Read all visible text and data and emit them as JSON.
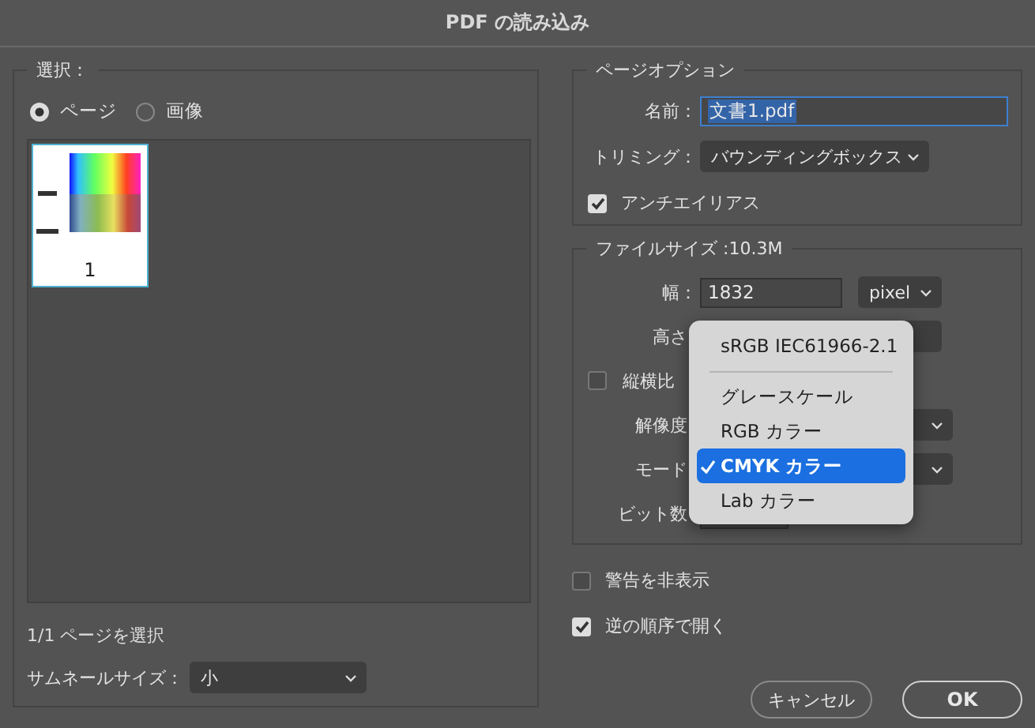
{
  "window": {
    "title": "PDF の読み込み"
  },
  "selection": {
    "legend": "選択：",
    "options": [
      {
        "label": "ページ",
        "selected": true
      },
      {
        "label": "画像",
        "selected": false
      }
    ],
    "thumbnails": [
      {
        "label": "1",
        "selected": true
      }
    ],
    "status": "1/1 ページを選択",
    "thumbnail_size": {
      "label": "サムネールサイズ：",
      "value": "小"
    }
  },
  "page_options": {
    "legend": "ページオプション",
    "name": {
      "label": "名前：",
      "value": "文書1.pdf"
    },
    "crop": {
      "label": "トリミング：",
      "value": "バウンディングボックス"
    },
    "antialias": {
      "label": "アンチエイリアス",
      "checked": true
    }
  },
  "image_size": {
    "legend": "ファイルサイズ :10.3M",
    "rows": [
      {
        "kind": "size",
        "label": "幅：",
        "value": "1832",
        "unit": "pixel"
      },
      {
        "kind": "size",
        "label": "高さ"
      },
      {
        "kind": "checkbox",
        "label": "縦横比",
        "checked": false
      },
      {
        "kind": "select",
        "label": "解像度"
      },
      {
        "kind": "select",
        "label": "モード"
      },
      {
        "kind": "field",
        "label": "ビット数"
      }
    ]
  },
  "mode_menu": {
    "items": [
      {
        "kind": "header",
        "label": "sRGB IEC61966-2.1"
      },
      {
        "kind": "separator"
      },
      {
        "kind": "option",
        "label": "グレースケール",
        "selected": false
      },
      {
        "kind": "option",
        "label": "RGB カラー",
        "selected": false
      },
      {
        "kind": "option",
        "label": "CMYK カラー",
        "selected": true
      },
      {
        "kind": "option",
        "label": "Lab カラー",
        "selected": false
      }
    ]
  },
  "options": [
    {
      "label": "警告を非表示",
      "checked": false
    },
    {
      "label": "逆の順序で開く",
      "checked": true
    }
  ],
  "buttons": [
    {
      "label": "キャンセル",
      "default": false
    },
    {
      "label": "OK",
      "default": true
    }
  ]
}
